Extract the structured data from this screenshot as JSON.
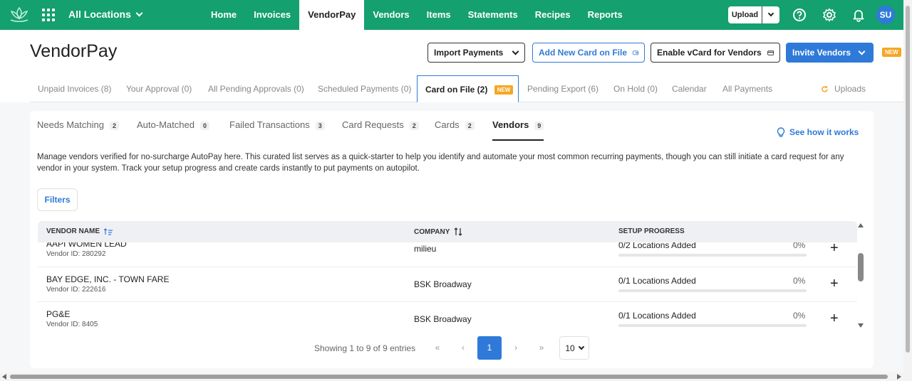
{
  "topbar": {
    "location": "All Locations",
    "nav": [
      "Home",
      "Invoices",
      "VendorPay",
      "Vendors",
      "Items",
      "Statements",
      "Recipes",
      "Reports"
    ],
    "active_nav": "VendorPay",
    "upload_label": "Upload",
    "avatar_initials": "SU"
  },
  "header": {
    "title": "VendorPay",
    "import_label": "Import Payments",
    "add_card_label": "Add New Card on File",
    "enable_vcard_label": "Enable vCard for Vendors",
    "invite_label": "Invite Vendors",
    "new_badge": "NEW"
  },
  "main_tabs": {
    "unpaid": "Unpaid Invoices (8)",
    "your_approval": "Your Approval (0)",
    "all_pending": "All Pending Approvals (0)",
    "scheduled": "Scheduled Payments (0)",
    "card_on_file": "Card on File (2)",
    "card_new_badge": "NEW",
    "pending_export": "Pending Export (6)",
    "on_hold": "On Hold (0)",
    "calendar": "Calendar",
    "all_payments": "All Payments",
    "uploads": "Uploads"
  },
  "sub_tabs": {
    "needs_matching": {
      "label": "Needs Matching",
      "count": "2"
    },
    "auto_matched": {
      "label": "Auto-Matched",
      "count": "0"
    },
    "failed": {
      "label": "Failed Transactions",
      "count": "3"
    },
    "card_requests": {
      "label": "Card Requests",
      "count": "2"
    },
    "cards": {
      "label": "Cards",
      "count": "2"
    },
    "vendors": {
      "label": "Vendors",
      "count": "9"
    }
  },
  "see_how": "See how it works",
  "description": "Manage vendors verified for no-surcharge AutoPay here. This curated list serves as a quick-starter to help you identify and automate your most common recurring payments, though you can still initiate a card request for any vendor in your system. Track your setup progress and create cards instantly to put payments on autopilot.",
  "filters_label": "Filters",
  "table": {
    "headers": {
      "vendor": "VENDOR NAME",
      "company": "COMPANY",
      "progress": "SETUP PROGRESS"
    },
    "rows": [
      {
        "name": "AAPI WOMEN LEAD",
        "vendor_id": "Vendor ID: 280292",
        "company": "milieu",
        "progress": "0/2 Locations Added",
        "percent": "0%",
        "fill": 0
      },
      {
        "name": "BAY EDGE, INC. - TOWN FARE",
        "vendor_id": "Vendor ID: 222616",
        "company": "BSK Broadway",
        "progress": "0/1 Locations Added",
        "percent": "0%",
        "fill": 0
      },
      {
        "name": "PG&E",
        "vendor_id": "Vendor ID: 8405",
        "company": "BSK Broadway",
        "progress": "0/1 Locations Added",
        "percent": "0%",
        "fill": 0
      }
    ]
  },
  "pagination": {
    "showing": "Showing 1 to 9 of 9 entries",
    "current_page": "1",
    "page_size": "10"
  },
  "colors": {
    "brand_green": "#14a06f",
    "accent_blue": "#2f7ad8",
    "badge_orange": "#f6a623"
  }
}
